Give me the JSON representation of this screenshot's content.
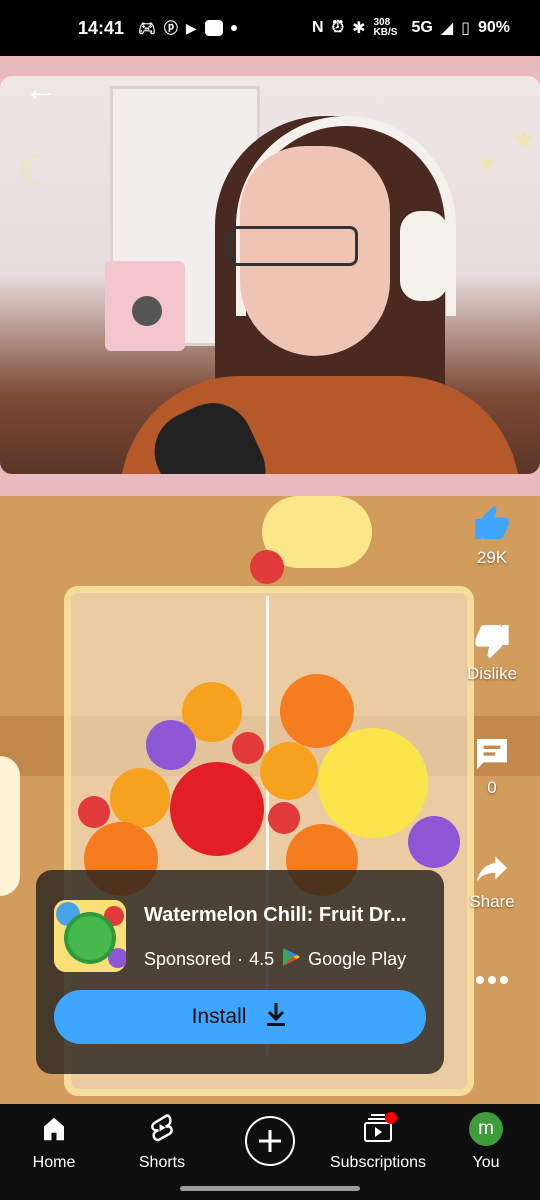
{
  "status_bar": {
    "time": "14:41",
    "network_speed": "308 KB/S",
    "network": "5G",
    "battery": "90%"
  },
  "video": {
    "back_icon": "back-arrow-icon"
  },
  "actions": {
    "like_count": "29K",
    "dislike_label": "Dislike",
    "comment_count": "0",
    "share_label": "Share",
    "more_icon": "more-icon"
  },
  "ad": {
    "title": "Watermelon Chill: Fruit Dr...",
    "sponsored": "Sponsored",
    "separator": "·",
    "rating": "4.5",
    "store": "Google Play",
    "install_label": "Install"
  },
  "nav": {
    "home": "Home",
    "shorts": "Shorts",
    "subscriptions": "Subscriptions",
    "you": "You",
    "avatar_letter": "m"
  },
  "colors": {
    "accent": "#3ea6ff",
    "notification": "#ff0000",
    "avatar": "#3e9c3a"
  }
}
